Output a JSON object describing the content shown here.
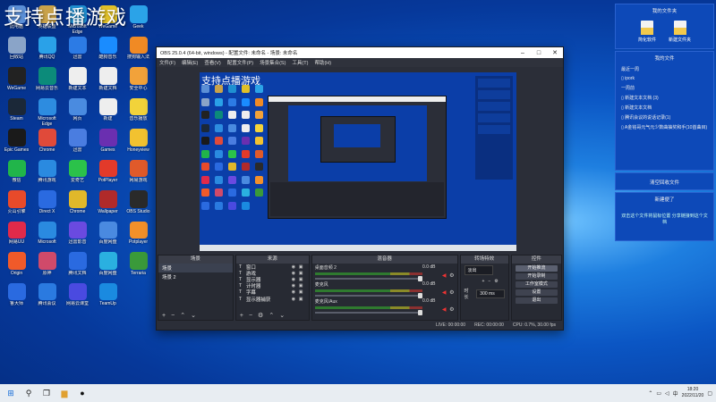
{
  "watermark": "支持点播游戏",
  "desktop_icons": [
    {
      "label": "此电脑",
      "color": "#5b8fd6"
    },
    {
      "label": "英雄联盟",
      "color": "#c9a24a"
    },
    {
      "label": "Microsoft Edge",
      "color": "#1f8fd1"
    },
    {
      "label": "WeGame",
      "color": "#e0c028"
    },
    {
      "label": "Geek",
      "color": "#2ba3e8"
    },
    {
      "label": "回收站",
      "color": "#8aa4c8"
    },
    {
      "label": "腾讯QQ",
      "color": "#2aa1e8"
    },
    {
      "label": "迅雷",
      "color": "#2c7be5"
    },
    {
      "label": "酷狗音乐",
      "color": "#1a8cff"
    },
    {
      "label": "搜狗输入法",
      "color": "#f08a24"
    },
    {
      "label": "WeGame",
      "color": "#222"
    },
    {
      "label": "网易云音乐",
      "color": "#0c8b7a"
    },
    {
      "label": "新建文本",
      "color": "#eee"
    },
    {
      "label": "新建文档",
      "color": "#eee"
    },
    {
      "label": "安全中心",
      "color": "#f2a23a"
    },
    {
      "label": "Steam",
      "color": "#1b2838"
    },
    {
      "label": "Microsoft Edge",
      "color": "#2d8ce0"
    },
    {
      "label": "网页",
      "color": "#4a8be0"
    },
    {
      "label": "新建",
      "color": "#eee"
    },
    {
      "label": "音乐播放",
      "color": "#f2d33a"
    },
    {
      "label": "Epic Games",
      "color": "#1a1a1a"
    },
    {
      "label": "Chrome",
      "color": "#e04a3a"
    },
    {
      "label": "迅雷",
      "color": "#4a7de0"
    },
    {
      "label": "Games",
      "color": "#6a2fb0"
    },
    {
      "label": "Honeyview",
      "color": "#f2c230"
    },
    {
      "label": "微信",
      "color": "#21b54a"
    },
    {
      "label": "腾讯游戏",
      "color": "#2a8ae0"
    },
    {
      "label": "爱奇艺",
      "color": "#2bc24a"
    },
    {
      "label": "PotPlayer",
      "color": "#e23a2a"
    },
    {
      "label": "网易游戏",
      "color": "#e05a2a"
    },
    {
      "label": "火山引擎",
      "color": "#e84a2a"
    },
    {
      "label": "Direct X",
      "color": "#2a6ae0"
    },
    {
      "label": "Chrome",
      "color": "#e0b82a"
    },
    {
      "label": "Wallpaper",
      "color": "#b02a2a"
    },
    {
      "label": "OBS Studio",
      "color": "#2a2a2a"
    },
    {
      "label": "网易UU",
      "color": "#e02a4a"
    },
    {
      "label": "Microsoft",
      "color": "#2a8ae0"
    },
    {
      "label": "迅雷影音",
      "color": "#6a4ae0"
    },
    {
      "label": "百度网盘",
      "color": "#4a8ae0"
    },
    {
      "label": "Potplayer",
      "color": "#f2902a"
    },
    {
      "label": "Origin",
      "color": "#f05a2a"
    },
    {
      "label": "原神",
      "color": "#d04a6a"
    },
    {
      "label": "腾讯文档",
      "color": "#2a6ae0"
    },
    {
      "label": "百度网盘",
      "color": "#2ab0e0"
    },
    {
      "label": "Terraria",
      "color": "#3a9a3a"
    },
    {
      "label": "鲁大师",
      "color": "#2a6ae0"
    },
    {
      "label": "腾讯会议",
      "color": "#2a7ae0"
    },
    {
      "label": "网易云课堂",
      "color": "#4a4ae0"
    },
    {
      "label": "TeamUp",
      "color": "#1a8ae0"
    },
    {
      "label": "",
      "color": "transparent"
    }
  ],
  "obs": {
    "title": "OBS 25.0.4 (64-bit, windows) - 配置文件: 未命名 - 场景: 未命名",
    "menu": [
      "文件(F)",
      "编辑(E)",
      "查看(V)",
      "配置文件(P)",
      "场景集合(S)",
      "工具(T)",
      "帮助(H)"
    ],
    "docks": {
      "scenes": {
        "title": "场景",
        "items": [
          "场景",
          "场景 2"
        ]
      },
      "sources": {
        "title": "来源",
        "items": [
          "窗口",
          "游戏",
          "显示器",
          "计时器",
          "字幕",
          "显示器捕获"
        ]
      },
      "mixer": {
        "title": "混音器",
        "rows": [
          {
            "name": "桌面音频 2",
            "db": "0.0 dB"
          },
          {
            "name": "麦克风",
            "db": "0.0 dB"
          },
          {
            "name": "麦克风/Aux",
            "db": "0.0 dB"
          }
        ]
      },
      "transitions": {
        "title": "转场特效",
        "mode": "淡出",
        "duration_label": "时长",
        "duration": "300 ms"
      },
      "controls": {
        "title": "控件",
        "buttons": [
          "开始推流",
          "开始录制",
          "工作室模式",
          "设置",
          "退出"
        ]
      }
    },
    "status": {
      "live": "LIVE: 00:00:00",
      "rec": "REC: 00:00:00",
      "cpu": "CPU: 0.7%, 30.00 fps"
    }
  },
  "right_panel": {
    "folder_box_title": "我的文件夹",
    "folders": [
      "简化软件",
      "新建文件夹"
    ],
    "files_title": "我的文件",
    "sections": [
      "最近一周",
      "一周前"
    ],
    "files": [
      "ipork",
      "新建文本文档 (3)",
      "新建文本文档",
      "腾讯会议的说话记录(1)",
      "A金铭哥元气元少数曲抽奖和手(10首曲目)"
    ],
    "recycle_label": "清空回收文件",
    "notes_title": "新建便了",
    "notes_text": "双击这个文件将鼠标位置 分享链接到这个文档"
  },
  "taskbar": {
    "time": "18:20",
    "date": "2022/11/20",
    "lang": "中"
  }
}
